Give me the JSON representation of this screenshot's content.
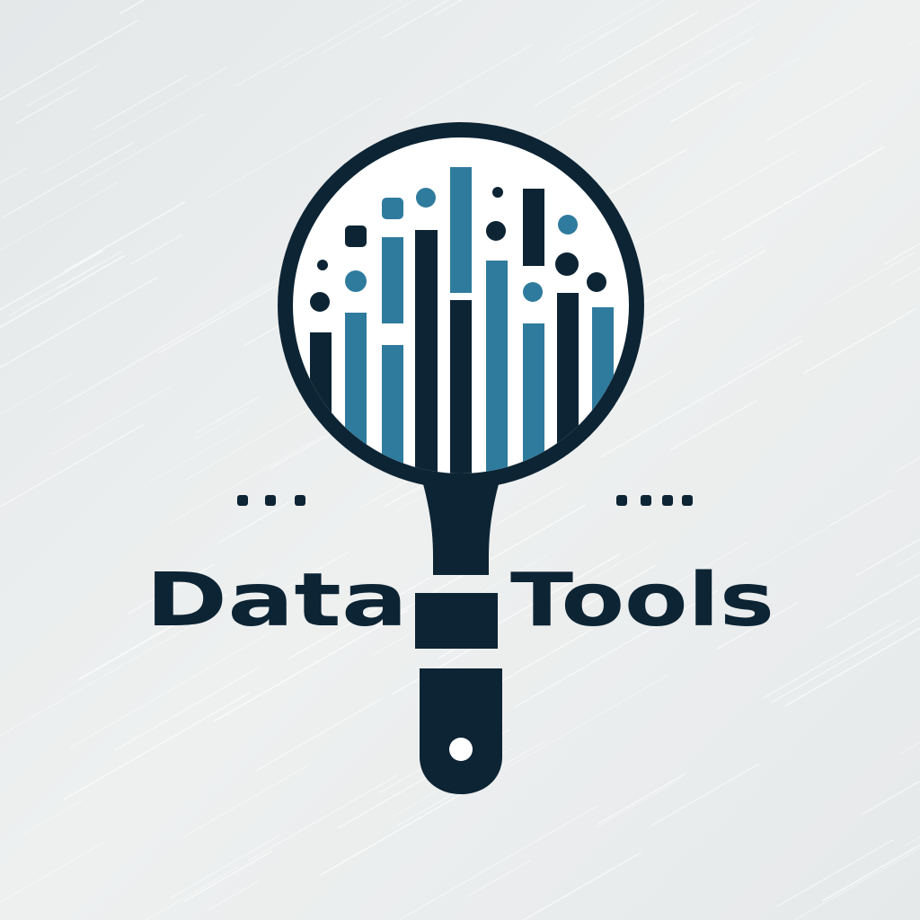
{
  "logo": {
    "wordmark_left": "Data",
    "wordmark_right": "Tools",
    "icon": "magnifying-glass-bar-chart-icon",
    "colors": {
      "background": "#e9ecec",
      "navy": "#0d2434",
      "teal": "#2f7b9e",
      "lens_fill": "#ffffff"
    }
  }
}
